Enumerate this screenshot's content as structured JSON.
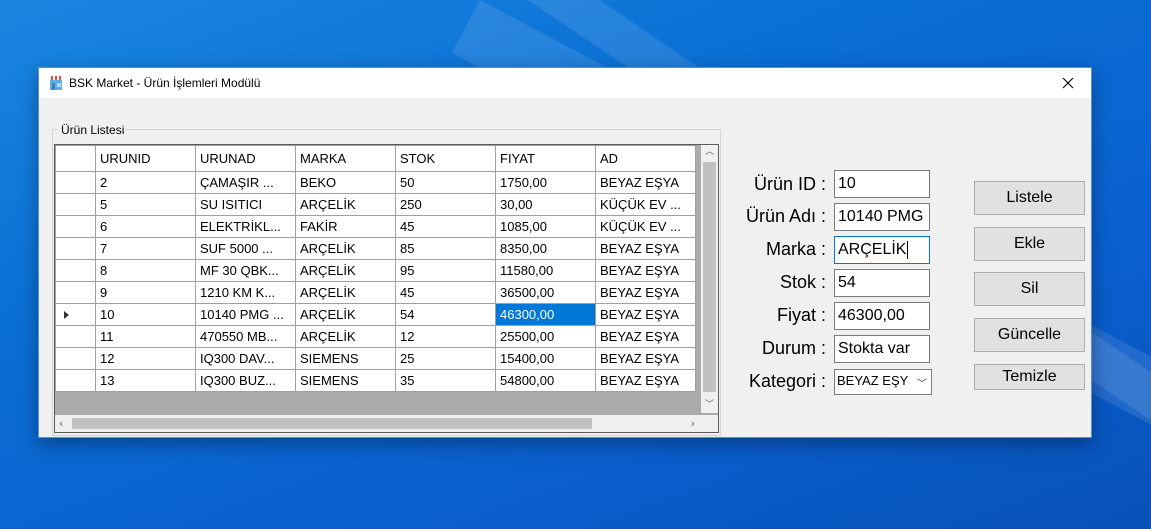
{
  "window": {
    "title": "BSK Market - Ürün İşlemleri Modülü"
  },
  "group": {
    "label": "Ürün Listesi"
  },
  "table": {
    "columns": [
      "URUNID",
      "URUNAD",
      "MARKA",
      "STOK",
      "FIYAT",
      "AD"
    ],
    "rows": [
      [
        "2",
        "ÇAMAŞIR ...",
        "BEKO",
        "50",
        "1750,00",
        "BEYAZ EŞYA"
      ],
      [
        "5",
        "SU ISITICI",
        "ARÇELİK",
        "250",
        "30,00",
        "KÜÇÜK EV ..."
      ],
      [
        "6",
        "ELEKTRİKL...",
        "FAKİR",
        "45",
        "1085,00",
        "KÜÇÜK EV ..."
      ],
      [
        "7",
        "SUF 5000 ...",
        "ARÇELİK",
        "85",
        "8350,00",
        "BEYAZ EŞYA"
      ],
      [
        "8",
        "MF 30 QBK...",
        "ARÇELİK",
        "95",
        "11580,00",
        "BEYAZ EŞYA"
      ],
      [
        "9",
        "1210 KM K...",
        "ARÇELİK",
        "45",
        "36500,00",
        "BEYAZ EŞYA"
      ],
      [
        "10",
        "10140 PMG ...",
        "ARÇELİK",
        "54",
        "46300,00",
        "BEYAZ EŞYA"
      ],
      [
        "11",
        "470550 MB...",
        "ARÇELİK",
        "12",
        "25500,00",
        "BEYAZ EŞYA"
      ],
      [
        "12",
        "IQ300 DAV...",
        "SIEMENS",
        "25",
        "15400,00",
        "BEYAZ EŞYA"
      ],
      [
        "13",
        "IQ300 BUZ...",
        "SIEMENS",
        "35",
        "54800,00",
        "BEYAZ EŞYA"
      ]
    ]
  },
  "form": {
    "id_label": "Ürün ID :",
    "id_value": "10",
    "name_label": "Ürün Adı :",
    "name_value": "10140 PMG",
    "brand_label": "Marka :",
    "brand_value": "ARÇELİK",
    "stock_label": "Stok :",
    "stock_value": "54",
    "price_label": "Fiyat :",
    "price_value": "46300,00",
    "status_label": "Durum :",
    "status_value": "Stokta var",
    "category_label": "Kategori :",
    "category_value": "BEYAZ EŞY"
  },
  "buttons": {
    "list": "Listele",
    "add": "Ekle",
    "delete": "Sil",
    "update": "Güncelle",
    "clear": "Temizle"
  },
  "icons": {
    "app": "store-icon",
    "close": "close-icon"
  },
  "colors": {
    "selection": "#0078d7",
    "desktop": "#0a6fd4"
  }
}
